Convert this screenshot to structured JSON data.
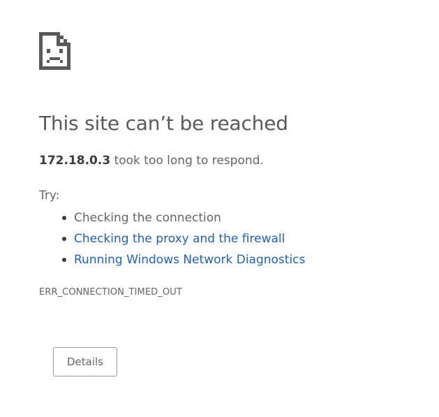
{
  "error": {
    "icon": "sad-page-icon",
    "title": "This site can’t be reached",
    "host": "172.18.0.3",
    "message": " took too long to respond.",
    "try_label": "Try:",
    "suggestions": [
      {
        "text": "Checking the connection",
        "is_link": false
      },
      {
        "text": "Checking the proxy and the firewall",
        "is_link": true
      },
      {
        "text": "Running Windows Network Diagnostics",
        "is_link": true
      }
    ],
    "error_code": "ERR_CONNECTION_TIMED_OUT",
    "details_button_label": "Details"
  },
  "colors": {
    "text": "#646464",
    "title": "#595959",
    "link": "#2060b8",
    "button_border": "#9a9a9a"
  }
}
